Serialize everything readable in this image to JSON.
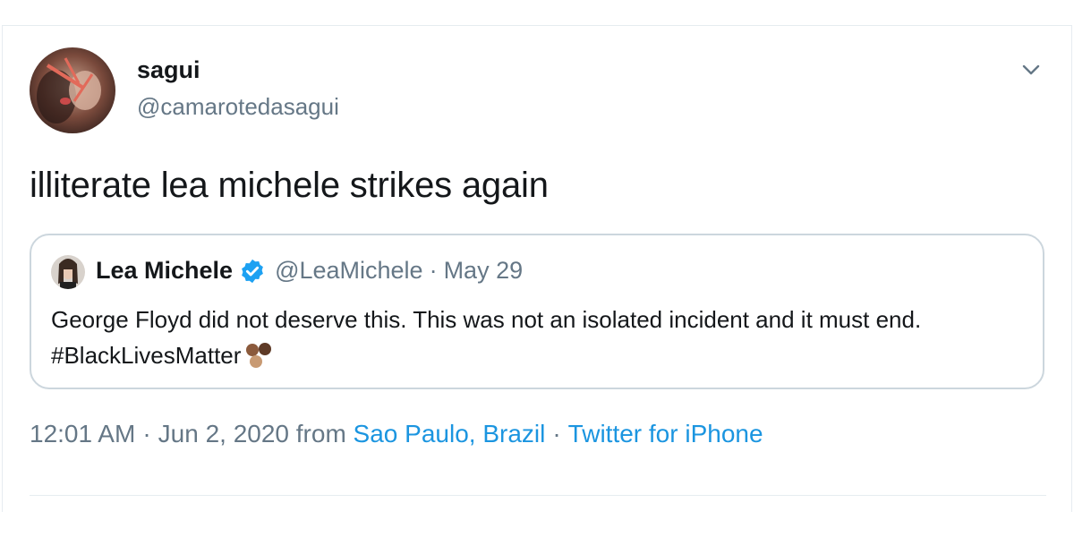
{
  "tweet": {
    "author": {
      "display_name": "sagui",
      "handle": "@camarotedasagui"
    },
    "text": "illiterate lea michele strikes again",
    "menu_icon": "chevron-down-icon",
    "quoted_tweet": {
      "author_name": "Lea Michele",
      "verified_icon": "verified-badge-icon",
      "handle": "@LeaMichele",
      "separator": "·",
      "date": "May 29",
      "body": "George Floyd did not deserve this. This was not an isolated incident and it must end. #BlackLivesMatter",
      "emoji_icon": "brown-hearts-emoji-icon"
    },
    "meta": {
      "time": "12:01 AM",
      "separator1": "·",
      "date": "Jun 2, 2020",
      "from_label": "from",
      "location": "Sao Paulo, Brazil",
      "separator2": "·",
      "source": "Twitter for iPhone"
    }
  },
  "colors": {
    "text_primary": "#14171a",
    "text_secondary": "#657786",
    "link": "#1b95e0",
    "verified_blue": "#1da1f2",
    "border": "#ccd6dd"
  }
}
